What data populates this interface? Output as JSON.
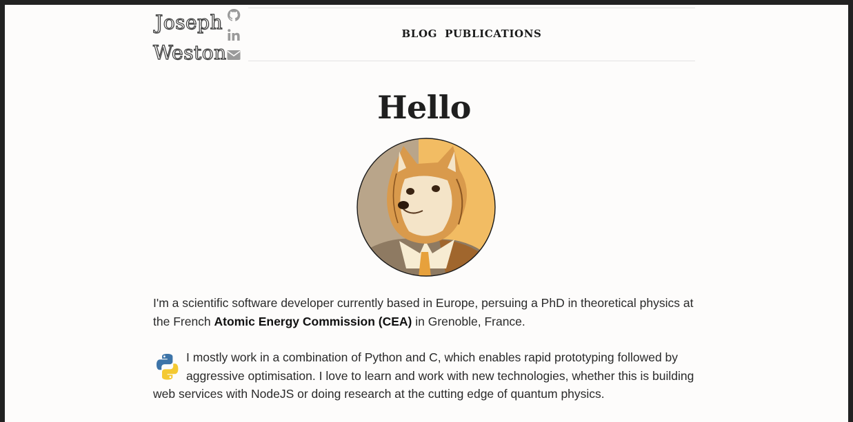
{
  "logo": {
    "first_name": "Joseph",
    "last_name": "Weston"
  },
  "social": {
    "github_icon": "github-icon",
    "linkedin_icon": "linkedin-icon",
    "email_icon": "envelope-icon"
  },
  "nav": {
    "blog": "BLOG",
    "publications": "PUBLICATIONS"
  },
  "main": {
    "title": "Hello",
    "avatar_icon": "doge-avatar",
    "intro": {
      "before": "I'm a scientific software developer currently based in Europe, persuing a PhD in theoretical physics at the French ",
      "bold": "Atomic Energy Commission (CEA)",
      "after": " in Grenoble, France."
    },
    "stack": {
      "icon": "python-icon",
      "text": "I mostly work in a combination of Python and C, which enables rapid prototyping followed by aggressive optimisation. I love to learn and work with new technologies, whether this is building web services with NodeJS or doing research at the cutting edge of quantum physics."
    }
  },
  "colors": {
    "page_bg": "#fdfcfb",
    "frame": "#222222",
    "text": "#2a2a2a",
    "icon_grey": "#9a9a9a"
  }
}
